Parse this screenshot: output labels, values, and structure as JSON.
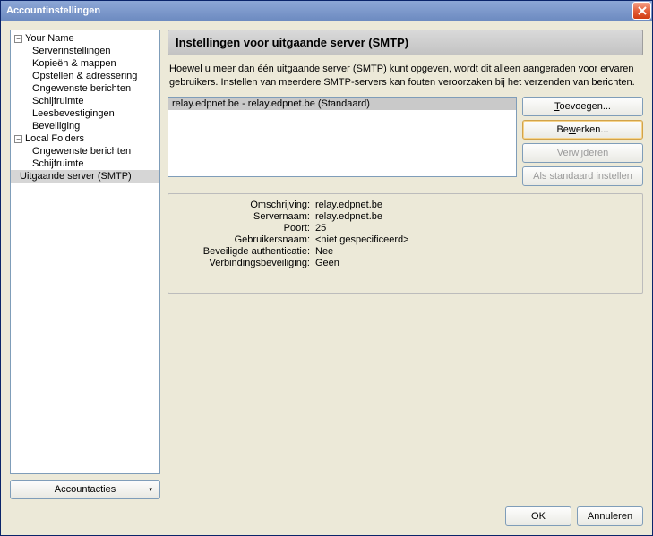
{
  "window": {
    "title": "Accountinstellingen"
  },
  "tree": {
    "group1": {
      "label": "Your Name",
      "items": [
        "Serverinstellingen",
        "Kopieën & mappen",
        "Opstellen & adressering",
        "Ongewenste berichten",
        "Schijfruimte",
        "Leesbevestigingen",
        "Beveiliging"
      ]
    },
    "group2": {
      "label": "Local Folders",
      "items": [
        "Ongewenste berichten",
        "Schijfruimte"
      ]
    },
    "selected": "Uitgaande server (SMTP)"
  },
  "account_actions": {
    "label": "Accountacties"
  },
  "panel": {
    "heading": "Instellingen voor uitgaande server (SMTP)",
    "description": "Hoewel u meer dan één uitgaande server (SMTP) kunt opgeven, wordt dit alleen aangeraden voor ervaren gebruikers. Instellen van meerdere SMTP-servers kan fouten veroorzaken bij het verzenden van berichten."
  },
  "serverlist": {
    "items": [
      "relay.edpnet.be - relay.edpnet.be (Standaard)"
    ]
  },
  "buttons": {
    "add": "Toevoegen...",
    "edit": "Bewerken...",
    "remove": "Verwijderen",
    "setdefault": "Als standaard instellen"
  },
  "details": {
    "labels": {
      "description": "Omschrijving:",
      "servername": "Servernaam:",
      "port": "Poort:",
      "username": "Gebruikersnaam:",
      "secureauth": "Beveiligde authenticatie:",
      "connsec": "Verbindingsbeveiliging:"
    },
    "values": {
      "description": "relay.edpnet.be",
      "servername": "relay.edpnet.be",
      "port": "25",
      "username": "<niet gespecificeerd>",
      "secureauth": "Nee",
      "connsec": "Geen"
    }
  },
  "dialog": {
    "ok": "OK",
    "cancel": "Annuleren"
  }
}
